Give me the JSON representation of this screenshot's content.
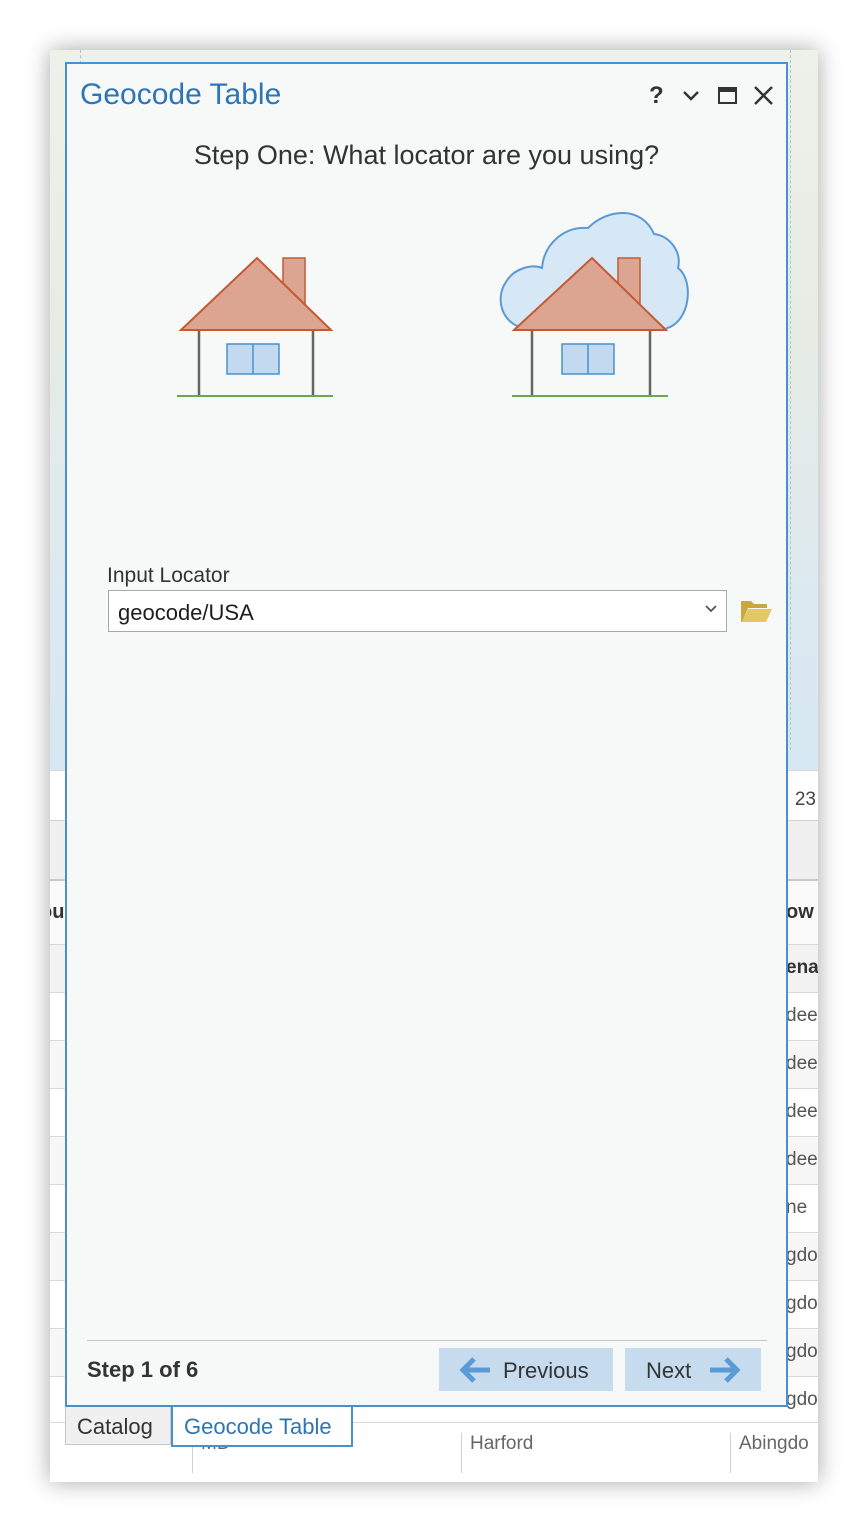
{
  "pane": {
    "title": "Geocode Table",
    "help_label": "?",
    "step_title": "Step One: What locator are you using?",
    "input_label": "Input Locator",
    "input_value": "geocode/USA",
    "step_count": "Step 1 of 6",
    "previous_label": "Previous",
    "next_label": "Next"
  },
  "tabs": {
    "catalog": "Catalog",
    "geocode_table": "Geocode Table"
  },
  "background": {
    "status_number": "23",
    "table_header_right": "ow",
    "table_header_left": "ou",
    "table_subheader_right": "ena",
    "table_rows_right": [
      "dee",
      "dee",
      "dee",
      "dee",
      "ne",
      "gdo",
      "gdo",
      "gdo",
      "gdo"
    ],
    "last_row": [
      "MD",
      "Harford",
      "Abingdo"
    ]
  },
  "colors": {
    "accent": "#2e75b6",
    "pane_border": "#4a8fcf",
    "button_bg": "#c6dbee",
    "house_roof": "#dca592",
    "house_window": "#c3d9ef",
    "cloud": "#d6e7f6",
    "folder": "#d9bf58"
  },
  "icons": {
    "help": "help-icon",
    "collapse": "chevron-down-icon",
    "maximize": "maximize-icon",
    "close": "close-icon",
    "browse": "folder-open-icon",
    "previous": "arrow-left-icon",
    "next": "arrow-right-icon"
  }
}
